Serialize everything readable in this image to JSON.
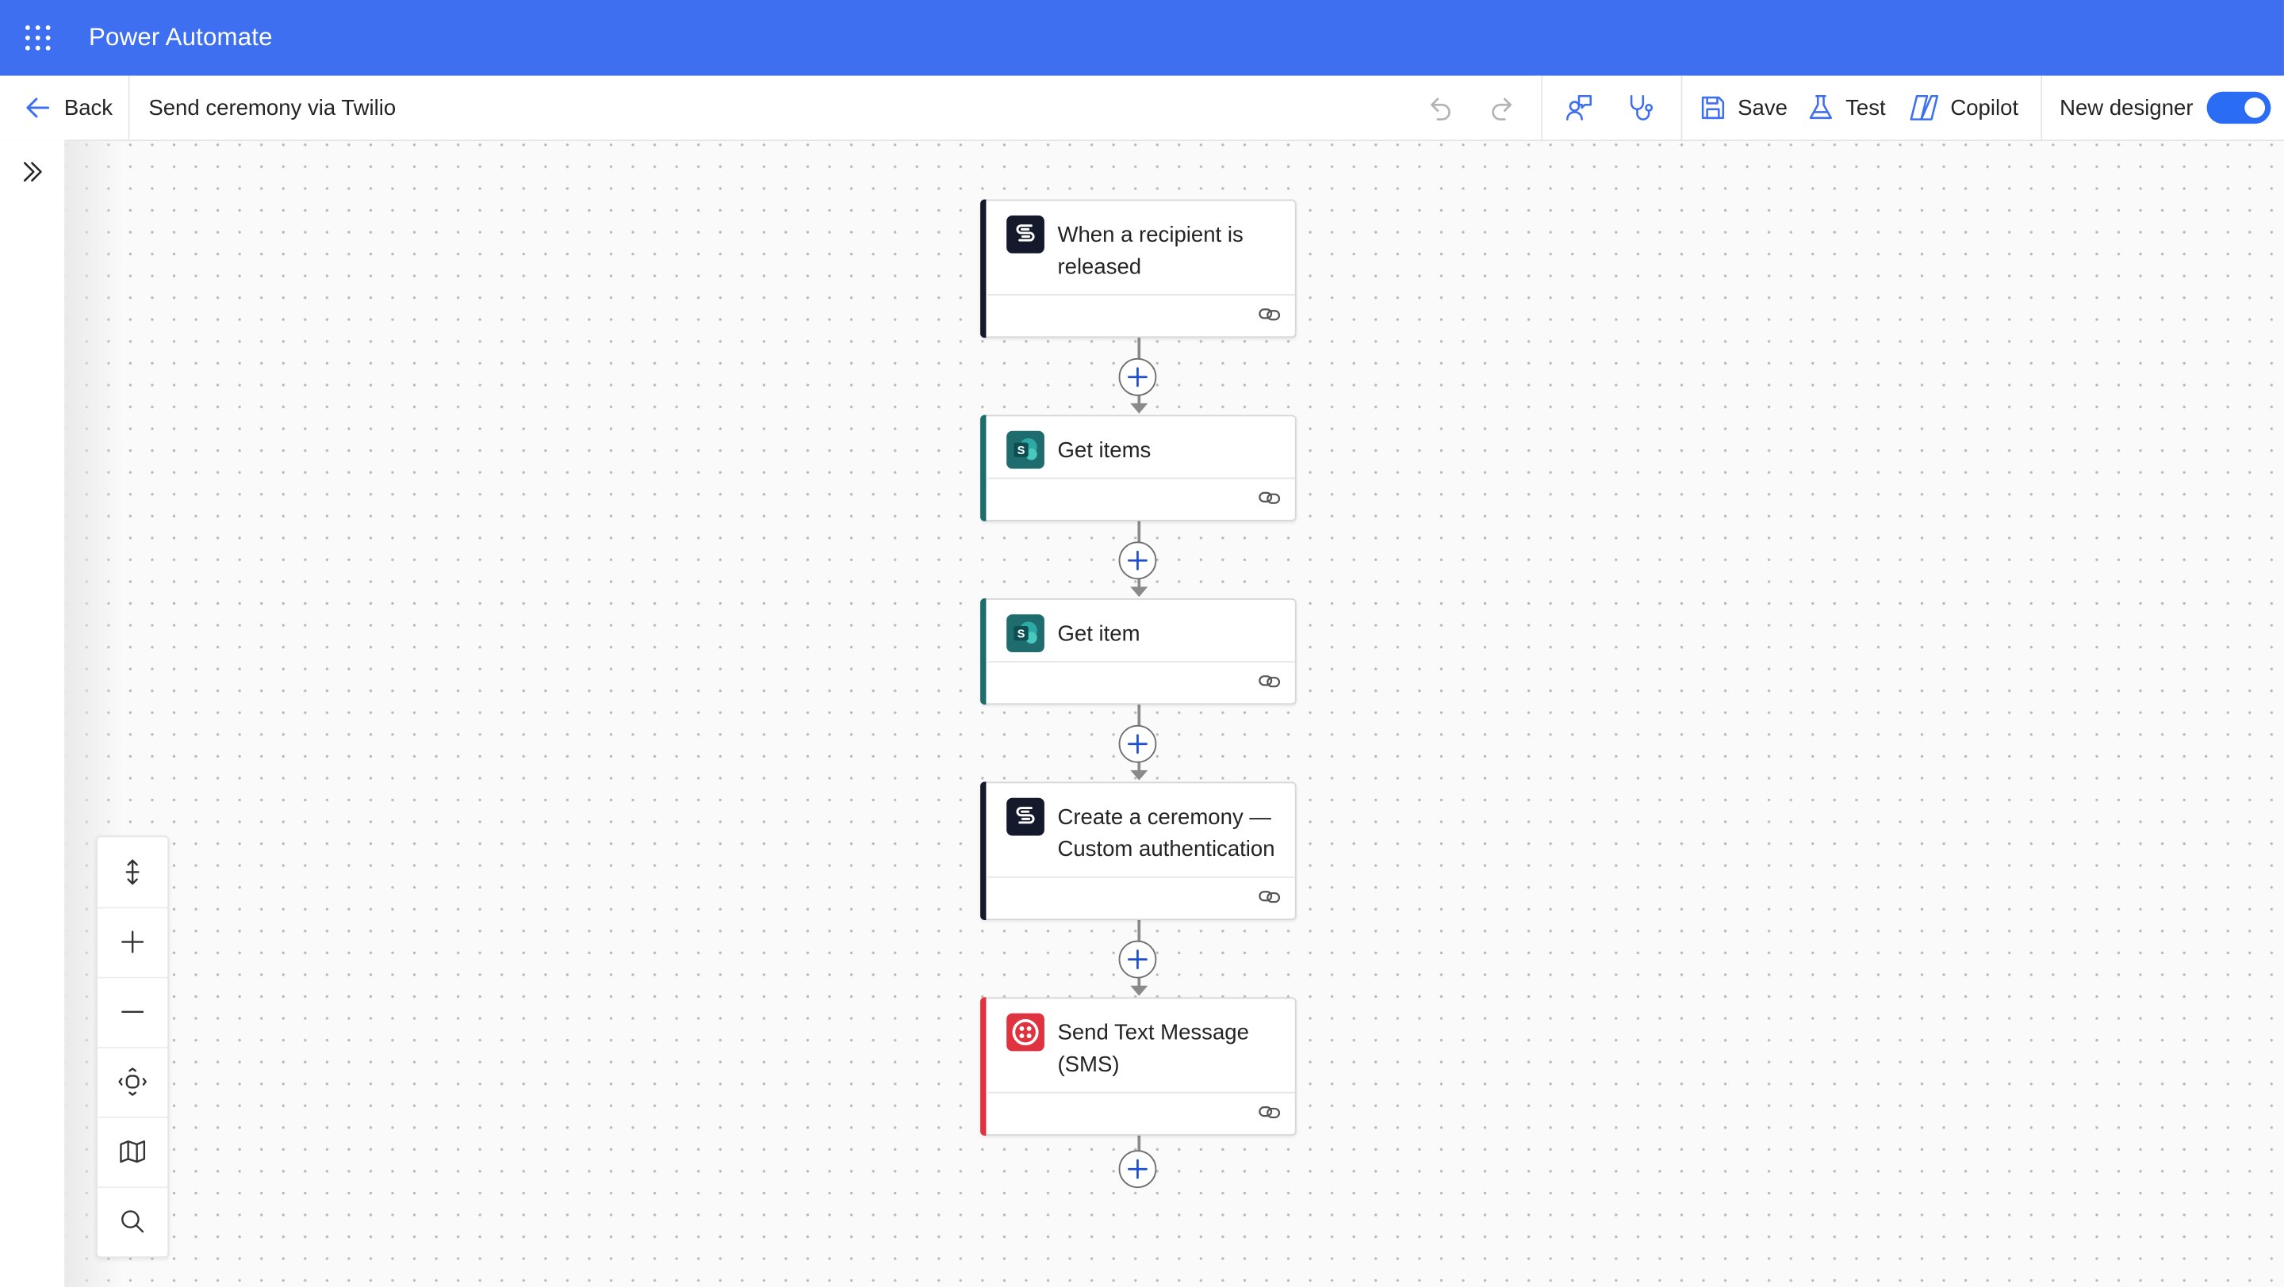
{
  "header": {
    "app_title": "Power Automate"
  },
  "commandbar": {
    "back_label": "Back",
    "flow_name": "Send ceremony via Twilio",
    "save_label": "Save",
    "test_label": "Test",
    "copilot_label": "Copilot",
    "new_designer_label": "New designer",
    "new_designer_on": true
  },
  "flow": {
    "steps": [
      {
        "title": "When a recipient is released",
        "connector": "signnow",
        "accent": "#141a2b"
      },
      {
        "title": "Get items",
        "connector": "sharepoint",
        "accent": "#1f6c6e"
      },
      {
        "title": "Get item",
        "connector": "sharepoint",
        "accent": "#1f6c6e"
      },
      {
        "title": "Create a ceremony — Custom authentication",
        "connector": "signnow",
        "accent": "#141a2b"
      },
      {
        "title": "Send Text Message (SMS)",
        "connector": "twilio",
        "accent": "#e03340"
      }
    ]
  },
  "icons": {
    "waffle": "app-launcher-icon",
    "back": "arrow-left-icon",
    "undo": "undo-icon",
    "redo": "redo-icon",
    "feedback": "person-feedback-icon",
    "checker": "stethoscope-icon",
    "save": "floppy-disk-icon",
    "test": "beaker-icon",
    "copilot": "copilot-icon",
    "link": "link-icon",
    "add": "plus-circle-icon"
  },
  "colors": {
    "brand": "#3d6ff0",
    "toggle": "#2b6cf5"
  }
}
